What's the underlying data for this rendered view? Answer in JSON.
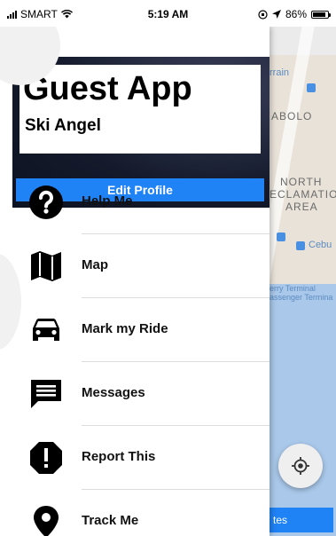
{
  "status_bar": {
    "carrier": "SMART",
    "time": "5:19 AM",
    "battery": "86%",
    "battery_level": 0.86
  },
  "map": {
    "labels": {
      "terrain": "rrain",
      "abolo": "ABOLO",
      "north": "NORTH",
      "reclamation": "ECLAMATIO",
      "area": "AREA",
      "cebu": "Cebu",
      "ferry1": "erry Terminal",
      "ferry2": "assenger Termina"
    },
    "bottom_button": "tes"
  },
  "drawer": {
    "header": {
      "title": "Guest App",
      "subtitle": "Ski Angel",
      "edit_profile": "Edit Profile"
    },
    "items": [
      {
        "label": "Help Me",
        "icon": "help-icon"
      },
      {
        "label": "Map",
        "icon": "map-icon"
      },
      {
        "label": "Mark my Ride",
        "icon": "car-icon"
      },
      {
        "label": "Messages",
        "icon": "message-icon"
      },
      {
        "label": "Report This",
        "icon": "report-icon"
      },
      {
        "label": "Track Me",
        "icon": "location-pin-icon"
      }
    ]
  },
  "colors": {
    "accent": "#1f82f5",
    "header_bg": "#141a2b"
  }
}
